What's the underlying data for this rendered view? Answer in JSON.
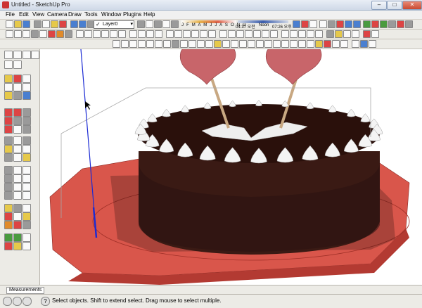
{
  "window": {
    "title": "Untitled - SketchUp Pro",
    "min": "–",
    "max": "□",
    "close": "✕"
  },
  "menu": [
    "File",
    "Edit",
    "View",
    "Camera",
    "Draw",
    "Tools",
    "Window",
    "Plugins",
    "Help"
  ],
  "layer": {
    "check": "✓",
    "name": "Layer0",
    "arrow": "▾"
  },
  "shadow": {
    "months": "J F M A M J J A S O N D",
    "time1": "04:37 오전",
    "noon": "Noon",
    "time2": "07:26 오후"
  },
  "measurements": {
    "label": "Measurements"
  },
  "status": {
    "help_icon": "?",
    "text": "Select objects. Shift to extend select. Drag mouse to select multiple."
  },
  "colors": {
    "chrome": "#d4d0c8",
    "plate": "#d9564b",
    "plate_dark": "#b33a32",
    "cake": "#3a1a14",
    "cake_top": "#2a100b",
    "meringue": "#f4f4f4",
    "heart": "#c8656a",
    "stick": "#c8a882",
    "axis": "#1a2ad4"
  }
}
